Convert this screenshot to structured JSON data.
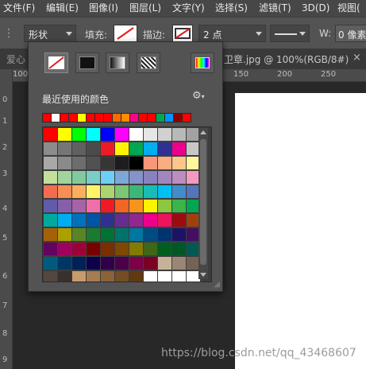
{
  "menubar": [
    "文件(F)",
    "编辑(E)",
    "图像(I)",
    "图层(L)",
    "文字(Y)",
    "选择(S)",
    "滤镜(T)",
    "3D(D)",
    "视图("
  ],
  "options": {
    "mode_value": "形状",
    "fill_label": "填充:",
    "stroke_label": "描边:",
    "stroke_size": "2 点",
    "width_label": "W:",
    "width_value": "0 像素"
  },
  "tab": {
    "left_text": "爱心",
    "doc_title": "卫章.jpg @ 100%(RGB/8#)",
    "close": "×"
  },
  "rulers": {
    "top_ticks": [
      "100",
      "50",
      "0",
      "50",
      "100",
      "150",
      "200",
      "250"
    ],
    "left_ticks": [
      "0",
      "1",
      "2",
      "3",
      "4",
      "5",
      "6",
      "7",
      "8",
      "9"
    ]
  },
  "popup": {
    "recent_label": "最近使用的颜色",
    "gear_icon": "⚙",
    "recent_colors": [
      "#ff0000",
      "#ffffff",
      "#ff0000",
      "#ff0000",
      "#ffff00",
      "#ff0000",
      "#ff0000",
      "#ff0000",
      "#ff6a00",
      "#ff8c00",
      "#ff0088",
      "#ff0000",
      "#ff0000",
      "#00a651",
      "#0094ff",
      "#8b0000",
      "#ff0000"
    ],
    "swatches": [
      [
        "#ff0000",
        "#ffff00",
        "#00ff00",
        "#00ffff",
        "#0000ff",
        "#ff00ff",
        "#ffffff",
        "#e6e6e6",
        "#d1d1d1",
        "#b9b9b9",
        "#a2a2a2"
      ],
      [
        "#8c8c8c",
        "#767676",
        "#606060",
        "#4b4b4b",
        "#ed1c24",
        "#fff200",
        "#00a651",
        "#00aeef",
        "#2e3192",
        "#ec008c",
        "#c7c7c7"
      ],
      [
        "#a8a8a8",
        "#8a8a8a",
        "#6d6d6d",
        "#515151",
        "#363636",
        "#1d1d1d",
        "#000000",
        "#f7977a",
        "#f9ad81",
        "#fdc68a",
        "#fff79a"
      ],
      [
        "#c4df9b",
        "#a3d39c",
        "#82ca9d",
        "#7bcdc8",
        "#6ecff6",
        "#7ea7d8",
        "#8493ca",
        "#8882be",
        "#a187be",
        "#bc8dbf",
        "#f49ac2"
      ],
      [
        "#f26c4f",
        "#f68e55",
        "#fbaf5c",
        "#fff467",
        "#acd372",
        "#7cc576",
        "#3bb878",
        "#1abbb4",
        "#00bff3",
        "#438ccb",
        "#5574b9"
      ],
      [
        "#605ca8",
        "#855fa8",
        "#a763a8",
        "#f06ea9",
        "#ed1c24",
        "#f26522",
        "#f7941d",
        "#fff200",
        "#8dc73f",
        "#39b54a",
        "#00a651"
      ],
      [
        "#00a99d",
        "#00aeef",
        "#0072bc",
        "#0054a6",
        "#2e3192",
        "#662d91",
        "#92278f",
        "#ec008c",
        "#ed145b",
        "#9e0b0f",
        "#a0410d"
      ],
      [
        "#a36209",
        "#aba000",
        "#598527",
        "#197b30",
        "#007236",
        "#00746b",
        "#0076a3",
        "#004b80",
        "#003471",
        "#1b1464",
        "#440e62"
      ],
      [
        "#630460",
        "#9e005d",
        "#9e0039",
        "#790000",
        "#7b2e00",
        "#7d4900",
        "#827b00",
        "#406618",
        "#005e20",
        "#005826",
        "#005952"
      ],
      [
        "#005b7f",
        "#003663",
        "#002157",
        "#0d004c",
        "#32004b",
        "#4b0049",
        "#7b0046",
        "#7a0026",
        "#c7b299",
        "#998675",
        "#736357"
      ],
      [
        "#534741",
        "#37302d",
        "#c69c6d",
        "#a67c52",
        "#8c6239",
        "#754c24",
        "#603913",
        "#ffffff",
        "#ffffff",
        "#ffffff",
        "#ffffff"
      ]
    ]
  },
  "watermark": "https://blog.csdn.net/qq_43468607",
  "colors": {
    "menubar_bg": "#474747",
    "options_bg": "#535353",
    "canvas_bg": "#282828"
  }
}
